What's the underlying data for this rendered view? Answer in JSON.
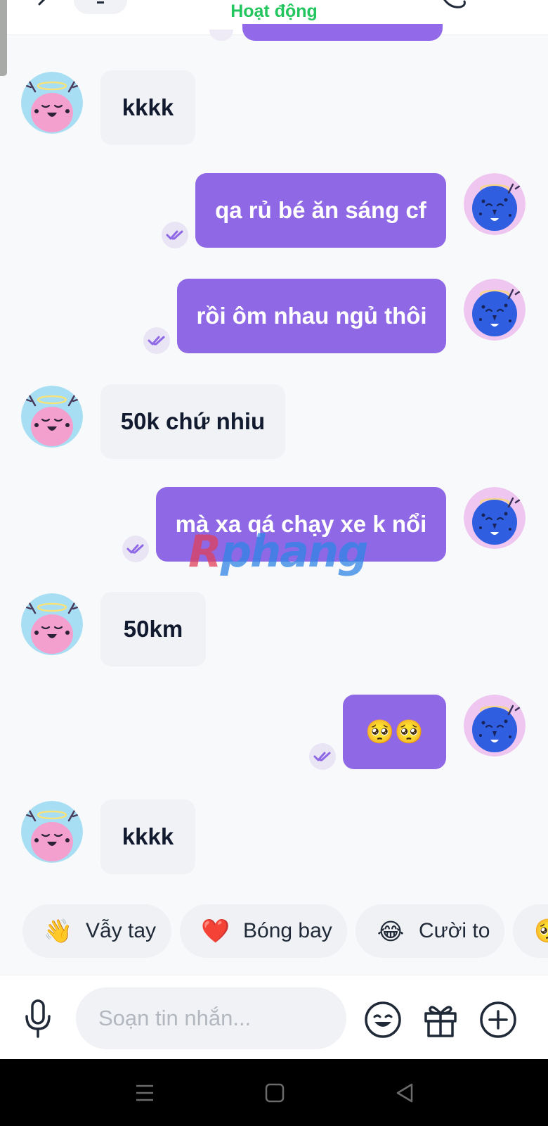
{
  "header": {
    "status": "Hoạt động"
  },
  "messages": [
    {
      "direction": "in",
      "text": "kkkk"
    },
    {
      "direction": "out",
      "text": "qa rủ bé ăn sáng cf"
    },
    {
      "direction": "out",
      "text": "rồi ôm nhau ngủ thôi"
    },
    {
      "direction": "in",
      "text": "50k chứ nhiu"
    },
    {
      "direction": "out",
      "text": "mà xa qá chạy xe k nổi"
    },
    {
      "direction": "in",
      "text": "50km"
    },
    {
      "direction": "out",
      "text": "🥺🥺"
    },
    {
      "direction": "in",
      "text": "kkkk"
    }
  ],
  "watermark": {
    "first": "R",
    "rest": "phang"
  },
  "quick_reactions": [
    {
      "emoji": "👋",
      "label": "Vẫy tay"
    },
    {
      "emoji": "❤️",
      "label": "Bóng bay"
    },
    {
      "emoji": "😂",
      "label": "Cười to"
    },
    {
      "emoji": "🥺",
      "label": ""
    }
  ],
  "composer": {
    "placeholder": "Soạn tin nhắn...",
    "value": ""
  },
  "colors": {
    "outgoing_bubble": "#8f68e6",
    "incoming_bubble": "#f1f2f5",
    "status_green": "#22c55e",
    "background": "#f8f9fb"
  },
  "icons": {
    "back": "back-arrow-icon",
    "call": "phone-icon",
    "read": "double-check-icon",
    "mic": "microphone-icon",
    "emoji": "emoji-icon",
    "gift": "gift-icon",
    "add": "plus-circle-icon"
  }
}
